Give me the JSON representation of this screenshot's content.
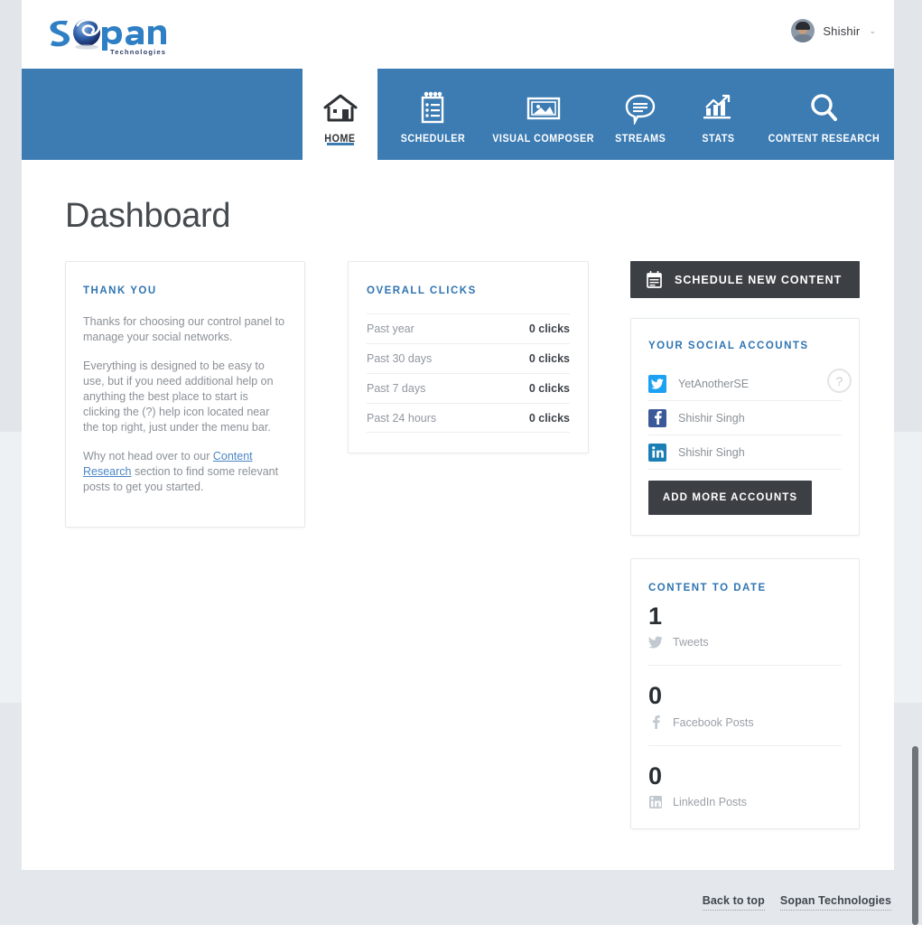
{
  "brand": {
    "logo_text_1": "S",
    "logo_text_2": "pan",
    "logo_subtitle": "Technologies",
    "logo_icon": "globe-swirl-icon",
    "nav_blue": "#3c7cb3",
    "title_blue": "#2f74b1",
    "dark_button": "#3c4045"
  },
  "header": {
    "user_name": "Shishir",
    "user_caret": "⌄",
    "avatar_icon": "user-avatar"
  },
  "nav": {
    "items": [
      {
        "id": "home",
        "label": "HOME",
        "icon": "house-icon",
        "active": true
      },
      {
        "id": "scheduler",
        "label": "SCHEDULER",
        "icon": "notepad-list-icon",
        "active": false
      },
      {
        "id": "visual",
        "label": "VISUAL COMPOSER",
        "icon": "image-icon",
        "active": false
      },
      {
        "id": "streams",
        "label": "STREAMS",
        "icon": "speech-bubble-icon",
        "active": false
      },
      {
        "id": "stats",
        "label": "STATS",
        "icon": "bar-chart-icon",
        "active": false
      },
      {
        "id": "research",
        "label": "CONTENT RESEARCH",
        "icon": "magnifier-icon",
        "active": false
      }
    ]
  },
  "main": {
    "page_title": "Dashboard",
    "help_icon_label": "?"
  },
  "thank_you": {
    "title": "THANK YOU",
    "para1": "Thanks for choosing our control panel to manage your social networks.",
    "para2": "Everything is designed to be easy to use, but if you need additional help on anything the best place to start is clicking the (?) help icon located near the top right, just under the menu bar.",
    "para3_before": "Why not head over to our ",
    "para3_link": "Content Research",
    "para3_after": " section to find some relevant posts to get you started."
  },
  "overall_clicks": {
    "title": "OVERALL CLICKS",
    "rows": [
      {
        "label": "Past year",
        "value": "0 clicks"
      },
      {
        "label": "Past 30 days",
        "value": "0 clicks"
      },
      {
        "label": "Past 7 days",
        "value": "0 clicks"
      },
      {
        "label": "Past 24 hours",
        "value": "0 clicks"
      }
    ]
  },
  "schedule_button": {
    "label": "SCHEDULE NEW CONTENT",
    "icon": "calendar-icon"
  },
  "social_accounts": {
    "title": "YOUR SOCIAL ACCOUNTS",
    "accounts": [
      {
        "network": "twitter",
        "name": "YetAnotherSE",
        "color": "#1da1f2",
        "icon": "twitter-icon"
      },
      {
        "network": "facebook",
        "name": "Shishir Singh",
        "color": "#3b5998",
        "icon": "facebook-icon"
      },
      {
        "network": "linkedin",
        "name": "Shishir Singh",
        "color": "#1b7fb6",
        "icon": "linkedin-icon"
      }
    ],
    "add_button_label": "ADD MORE ACCOUNTS"
  },
  "content_to_date": {
    "title": "CONTENT TO DATE",
    "items": [
      {
        "count": "1",
        "label": "Tweets",
        "icon": "twitter-icon",
        "color": "#c3c9d0"
      },
      {
        "count": "0",
        "label": "Facebook Posts",
        "icon": "facebook-icon",
        "color": "#c3c9d0"
      },
      {
        "count": "0",
        "label": "LinkedIn Posts",
        "icon": "linkedin-icon",
        "color": "#c3c9d0"
      }
    ]
  },
  "footer": {
    "back_to_top": "Back to top",
    "company": "Sopan Technologies"
  }
}
